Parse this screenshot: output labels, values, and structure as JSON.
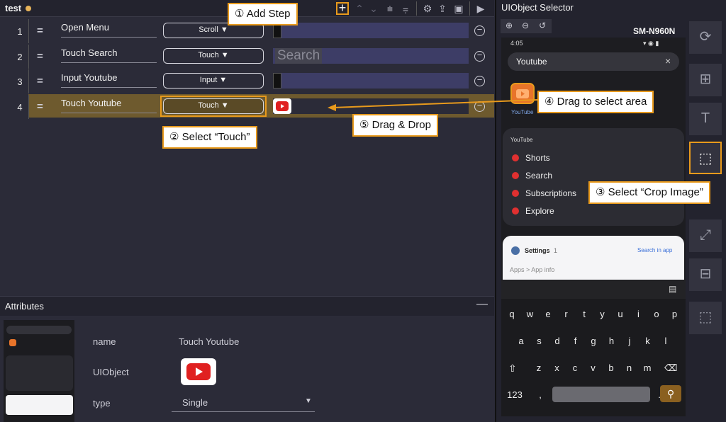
{
  "editor": {
    "tab_title": "test",
    "toolbar_icons": [
      "add-step-icon",
      "move-up-icon",
      "move-down-icon",
      "expand-icon",
      "collapse-icon",
      "settings-icon",
      "export-icon",
      "save-icon",
      "play-icon"
    ],
    "steps": [
      {
        "num": "1",
        "name": "Open Menu",
        "action": "Scroll ▼",
        "target": "image"
      },
      {
        "num": "2",
        "name": "Touch Search",
        "action": "Touch ▼",
        "target": "Search"
      },
      {
        "num": "3",
        "name": "Input Youtube",
        "action": "Input ▼",
        "target": "image"
      },
      {
        "num": "4",
        "name": "Touch Youtube",
        "action": "Touch ▼",
        "target": "youtube-logo"
      }
    ]
  },
  "callouts": {
    "add_step": "① Add Step",
    "select_touch": "② Select “Touch”",
    "crop_image": "③ Select “Crop Image”",
    "drag_select": "④ Drag to select area",
    "drag_drop": "⑤ Drag & Drop"
  },
  "attributes": {
    "title": "Attributes",
    "minimize": "—",
    "name_label": "name",
    "name_value": "Touch Youtube",
    "uiobject_label": "UIObject",
    "type_label": "type",
    "type_value": "Single"
  },
  "selector": {
    "title": "UIObject Selector",
    "device": "SM-N960N",
    "phone": {
      "time": "4:05",
      "search_text": "Youtube",
      "app_label": "YouTube",
      "section_title": "YouTube",
      "shortcuts": [
        "Shorts",
        "Search",
        "Subscriptions",
        "Explore"
      ],
      "settings_title": "Settings",
      "settings_count": "1",
      "search_in_app": "Search in app",
      "breadcrumb": "Apps > App info",
      "keys_row1": [
        "q",
        "w",
        "e",
        "r",
        "t",
        "y",
        "u",
        "i",
        "o",
        "p"
      ],
      "keys_row2": [
        "a",
        "s",
        "d",
        "f",
        "g",
        "h",
        "j",
        "k",
        "l"
      ],
      "keys_row3": [
        "z",
        "x",
        "c",
        "v",
        "b",
        "n",
        "m"
      ],
      "key_123": "123",
      "key_comma": ",",
      "key_period": "."
    }
  },
  "colors": {
    "accent": "#e89a1c",
    "selected_row": "#6e5a2e",
    "target_bg": "#3d3d66",
    "youtube_red": "#e02020"
  }
}
